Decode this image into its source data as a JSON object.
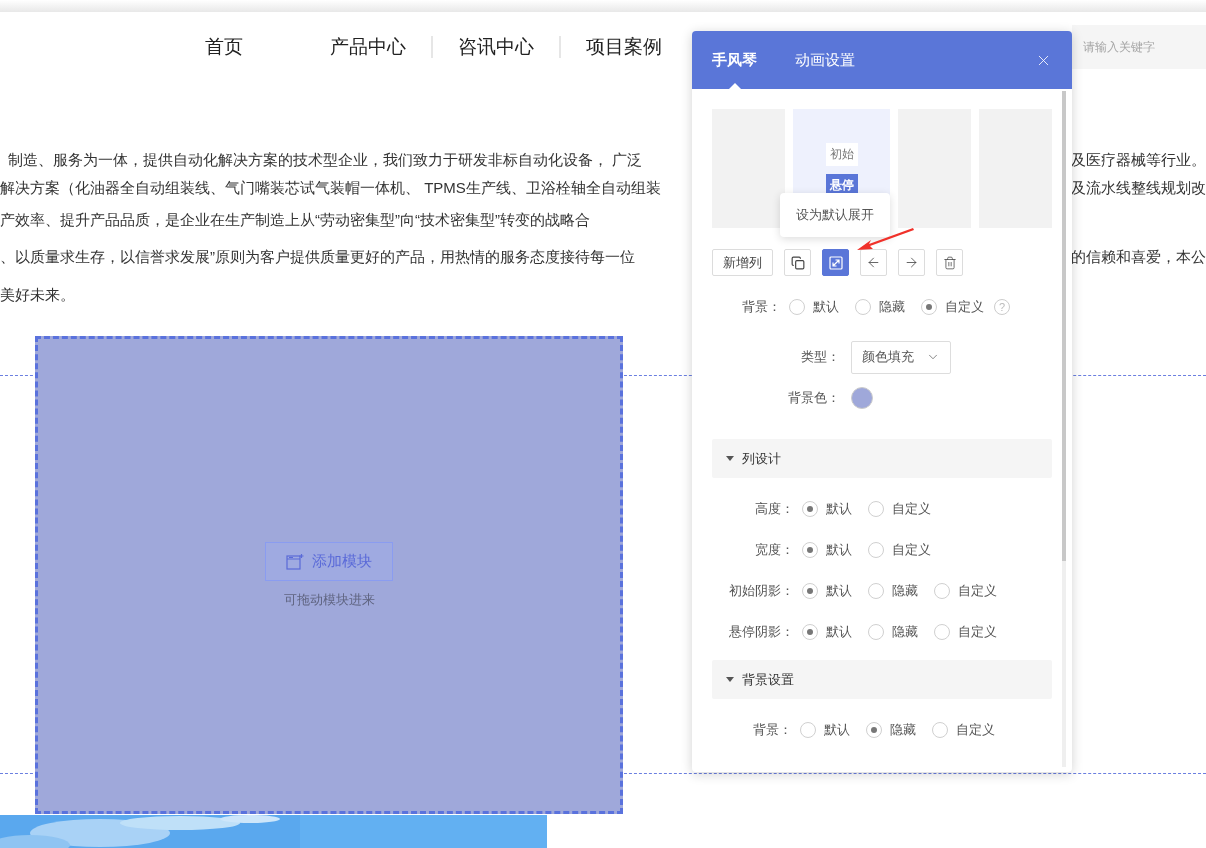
{
  "nav": {
    "items": [
      "首页",
      "产品中心",
      "咨讯中心",
      "项目案例"
    ],
    "search": {
      "placeholder": "请输入关键字"
    }
  },
  "article": {
    "lines": [
      {
        "left": "制造、服务为一体，提供自动化解决方案的技术型企业，我们致力于研发非标自动化设备， 广泛",
        "right": "及医疗器械等行业。"
      },
      {
        "left": "解决方案（化油器全自动组装线、气门嘴装芯试气装帽一体机、 TPMS生产线、卫浴栓轴全自动组装",
        "right": "及流水线整线规划改"
      },
      {
        "left": "产效率、提升产品品质，是企业在生产制造上从“劳动密集型”向“技术密集型”转变的战略合"
      },
      {
        "left": "、以质量求生存，以信誉求发展”原则为客户提供质量更好的产品，用热情的服务态度接待每一位",
        "right": "的信赖和喜爱，本公"
      },
      {
        "left": "美好未来。"
      }
    ]
  },
  "canvas": {
    "add_button": "添加模块",
    "hint": "可拖动模块进来"
  },
  "panel": {
    "tabs": [
      {
        "label": "手风琴",
        "selected": true
      },
      {
        "label": "动画设置",
        "selected": false
      }
    ],
    "columns": [
      {
        "selected": false
      },
      {
        "selected": true,
        "chips": [
          {
            "label": "初始",
            "selected": false
          },
          {
            "label": "悬停",
            "selected": true
          }
        ]
      },
      {
        "selected": false
      },
      {
        "selected": false
      }
    ],
    "tooltip": "设为默认展开",
    "toolbar": [
      {
        "kind": "text",
        "label": "新增列",
        "selected": false
      },
      {
        "kind": "copy",
        "selected": false
      },
      {
        "kind": "expand",
        "selected": true
      },
      {
        "kind": "left",
        "selected": false
      },
      {
        "kind": "right",
        "selected": false
      },
      {
        "kind": "delete",
        "selected": false
      }
    ],
    "background": {
      "label": "背景：",
      "help": "?",
      "options": [
        {
          "label": "默认",
          "selected": false
        },
        {
          "label": "隐藏",
          "selected": false
        },
        {
          "label": "自定义",
          "selected": true
        }
      ]
    },
    "type_field": {
      "label": "类型：",
      "value": "颜色填充"
    },
    "color_field": {
      "label": "背景色：",
      "color": "#9fa8da"
    },
    "sections": [
      {
        "title": "列设计",
        "expanded": true,
        "rows": [
          {
            "label": "高度：",
            "options": [
              {
                "label": "默认",
                "selected": true
              },
              {
                "label": "自定义",
                "selected": false
              }
            ]
          },
          {
            "label": "宽度：",
            "options": [
              {
                "label": "默认",
                "selected": true
              },
              {
                "label": "自定义",
                "selected": false
              }
            ]
          },
          {
            "label": "初始阴影：",
            "options": [
              {
                "label": "默认",
                "selected": true
              },
              {
                "label": "隐藏",
                "selected": false
              },
              {
                "label": "自定义",
                "selected": false
              }
            ]
          },
          {
            "label": "悬停阴影：",
            "options": [
              {
                "label": "默认",
                "selected": true
              },
              {
                "label": "隐藏",
                "selected": false
              },
              {
                "label": "自定义",
                "selected": false
              }
            ]
          }
        ]
      },
      {
        "title": "背景设置",
        "expanded": true,
        "rows": [
          {
            "label": "背景：",
            "options": [
              {
                "label": "默认",
                "selected": false
              },
              {
                "label": "隐藏",
                "selected": true
              },
              {
                "label": "自定义",
                "selected": false
              }
            ]
          }
        ]
      }
    ]
  }
}
